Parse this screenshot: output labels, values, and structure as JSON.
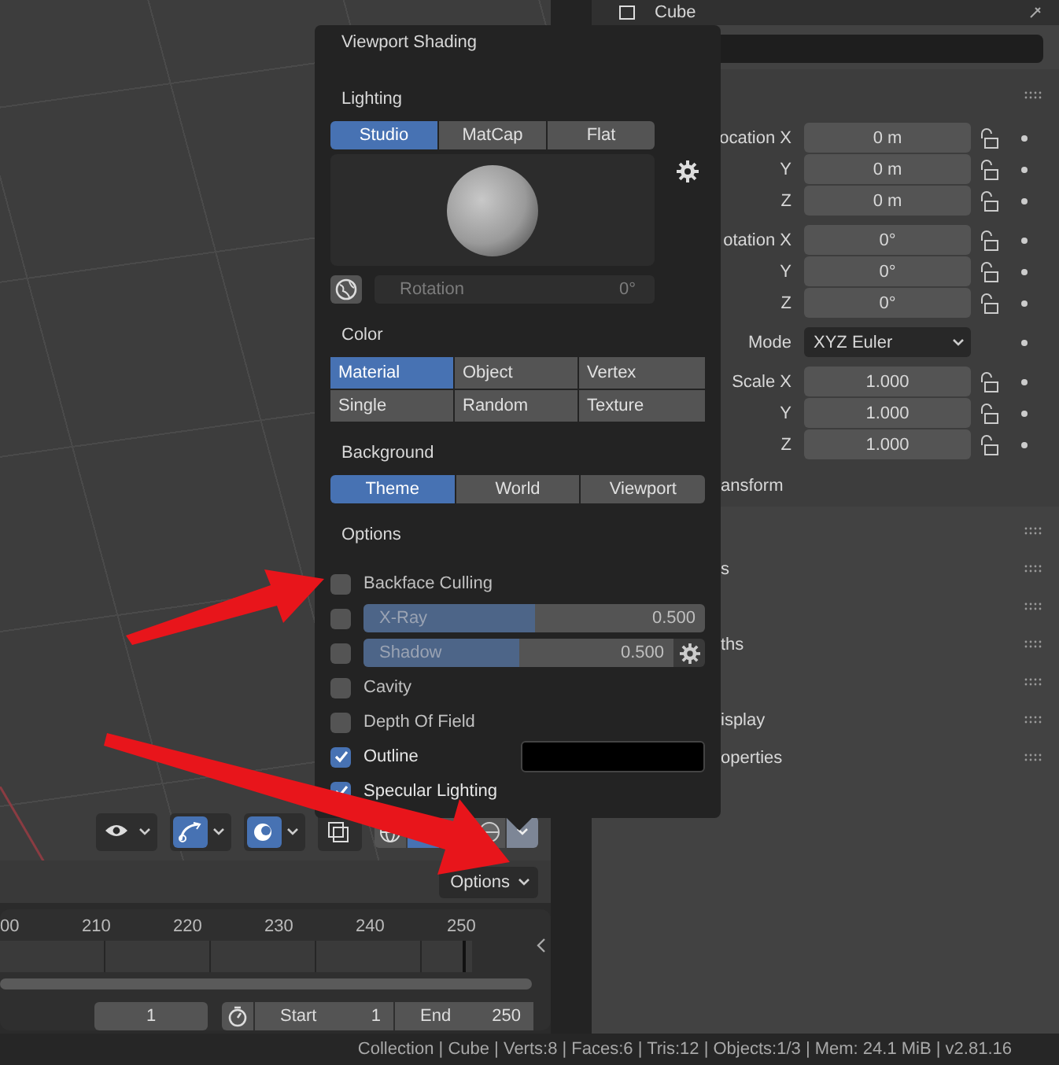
{
  "properties_header": {
    "object_name": "Cube"
  },
  "viewport_shading": {
    "title": "Viewport Shading",
    "lighting": {
      "label": "Lighting",
      "modes": [
        {
          "label": "Studio",
          "selected": true
        },
        {
          "label": "MatCap",
          "selected": false
        },
        {
          "label": "Flat",
          "selected": false
        }
      ],
      "rotation_label": "Rotation",
      "rotation_value": "0°"
    },
    "color": {
      "label": "Color",
      "options": [
        {
          "label": "Material",
          "selected": true
        },
        {
          "label": "Object",
          "selected": false
        },
        {
          "label": "Vertex",
          "selected": false
        },
        {
          "label": "Single",
          "selected": false
        },
        {
          "label": "Random",
          "selected": false
        },
        {
          "label": "Texture",
          "selected": false
        }
      ]
    },
    "background": {
      "label": "Background",
      "options": [
        {
          "label": "Theme",
          "selected": true
        },
        {
          "label": "World",
          "selected": false
        },
        {
          "label": "Viewport",
          "selected": false
        }
      ]
    },
    "options": {
      "label": "Options",
      "items": [
        {
          "kind": "checkbox",
          "label": "Backface Culling",
          "checked": false
        },
        {
          "kind": "slider",
          "label": "X-Ray",
          "checked": false,
          "level": 0.5,
          "value": "0.500"
        },
        {
          "kind": "slider",
          "label": "Shadow",
          "checked": false,
          "level": 0.5,
          "value": "0.500",
          "settings": true
        },
        {
          "kind": "checkbox",
          "label": "Cavity",
          "checked": false
        },
        {
          "kind": "checkbox",
          "label": "Depth Of Field",
          "checked": false
        },
        {
          "kind": "color",
          "label": "Outline",
          "checked": true,
          "color": "#000000"
        },
        {
          "kind": "checkbox",
          "label": "Specular Lighting",
          "checked": true
        }
      ]
    }
  },
  "transform": {
    "groups": [
      {
        "rows": [
          {
            "kind": "number",
            "label": "ocation X",
            "value": "0 m"
          },
          {
            "kind": "number",
            "label": "Y",
            "value": "0 m"
          },
          {
            "kind": "number",
            "label": "Z",
            "value": "0 m"
          }
        ]
      },
      {
        "rows": [
          {
            "kind": "number",
            "label": "otation X",
            "value": "0°"
          },
          {
            "kind": "number",
            "label": "Y",
            "value": "0°"
          },
          {
            "kind": "number",
            "label": "Z",
            "value": "0°"
          }
        ]
      },
      {
        "rows": [
          {
            "kind": "dropdown",
            "label": "Mode",
            "value": "XYZ Euler"
          }
        ]
      },
      {
        "rows": [
          {
            "kind": "number",
            "label": "Scale X",
            "value": "1.000"
          },
          {
            "kind": "number",
            "label": "Y",
            "value": "1.000"
          },
          {
            "kind": "number",
            "label": "Z",
            "value": "1.000"
          }
        ]
      }
    ],
    "subpanel_label": "ansform"
  },
  "subpanels": [
    {
      "label": "s"
    },
    {
      "label": "ths"
    },
    {
      "label": "isplay"
    },
    {
      "label": "operties"
    }
  ],
  "viewport_header": {
    "tools": [
      {
        "kind": "eye",
        "on": false,
        "dropdown": true
      },
      {
        "kind": "gizmo",
        "on": true,
        "dropdown": true
      },
      {
        "kind": "overlay",
        "on": true,
        "dropdown": true
      },
      {
        "kind": "xray",
        "on": false,
        "dropdown": false
      }
    ],
    "shading": [
      {
        "kind": "wireframe",
        "selected": false
      },
      {
        "kind": "solid",
        "selected": true
      },
      {
        "kind": "material",
        "selected": false
      },
      {
        "kind": "rendered",
        "selected": false
      }
    ],
    "popover_open": true,
    "options_label": "Options"
  },
  "timeline": {
    "ticks": [
      "00",
      "210",
      "220",
      "230",
      "240",
      "250"
    ],
    "current_frame": "1",
    "start_label": "Start",
    "start": "1",
    "end_label": "End",
    "end": "250"
  },
  "status_bar": "Collection | Cube | Verts:8 | Faces:6 | Tris:12 | Objects:1/3 | Mem: 24.1 MiB | v2.81.16"
}
